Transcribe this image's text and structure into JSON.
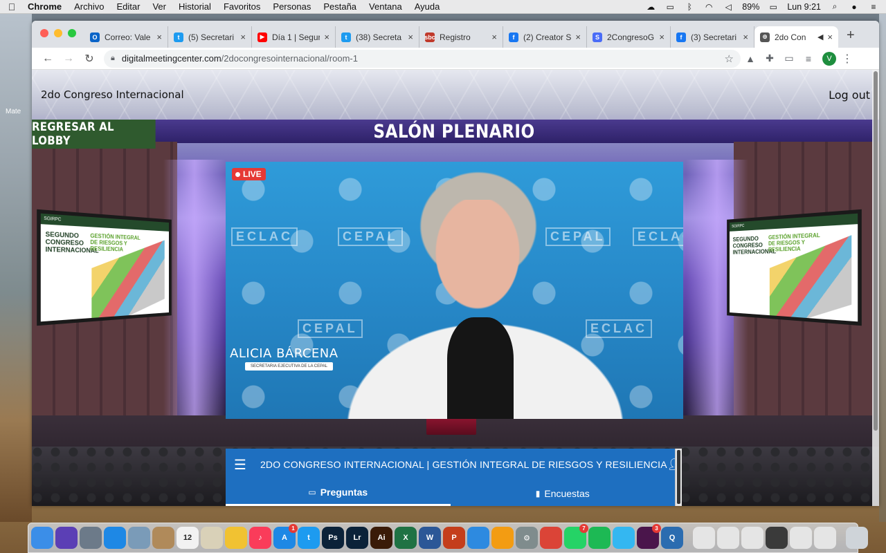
{
  "menubar": {
    "apple_icon": "apple-icon",
    "items": [
      "Chrome",
      "Archivo",
      "Editar",
      "Ver",
      "Historial",
      "Favoritos",
      "Personas",
      "Pestaña",
      "Ventana",
      "Ayuda"
    ],
    "battery": "89%",
    "clock": "Lun 9:21"
  },
  "desktop": {
    "icon_label": "Mate"
  },
  "browser": {
    "tabs": [
      {
        "title": "Correo: Vale",
        "favicon_text": "O",
        "favicon_color": "#0a64c8"
      },
      {
        "title": "(5) Secretari",
        "favicon_text": "t",
        "favicon_color": "#1d9bf0"
      },
      {
        "title": "Día 1 | Segur",
        "favicon_text": "▶",
        "favicon_color": "#ff0000"
      },
      {
        "title": "(38) Secreta",
        "favicon_text": "t",
        "favicon_color": "#1d9bf0"
      },
      {
        "title": "Registro",
        "favicon_text": "sbc",
        "favicon_color": "#c0392b"
      },
      {
        "title": "(2) Creator S",
        "favicon_text": "f",
        "favicon_color": "#1877f2"
      },
      {
        "title": "2CongresoG",
        "favicon_text": "S",
        "favicon_color": "#4a6cf7"
      },
      {
        "title": "(3) Secretari",
        "favicon_text": "f",
        "favicon_color": "#1877f2"
      },
      {
        "title": "2do Con",
        "favicon_text": "⊕",
        "favicon_color": "#555555",
        "active": true
      }
    ],
    "url_host": "digitalmeetingcenter.com",
    "url_path": "/2docongresointernacional/room-1",
    "profile_initial": "V"
  },
  "page": {
    "site_title": "2do Congreso Internacional",
    "logout_label": "Log out",
    "lobby_button": "REGRESAR AL LOBBY",
    "hall_title": "SALÓN PLENARIO",
    "side_screen": {
      "logo_text": "SGIRPC",
      "line1": [
        "SEGUNDO",
        "CONGRESO",
        "INTERNACIONAL"
      ],
      "line2": [
        "GESTIÓN INTEGRAL",
        "DE RIESGOS Y",
        "RESILIENCIA"
      ]
    },
    "video": {
      "live_label": "LIVE",
      "speaker_name": "ALICIA BÁRCENA",
      "speaker_role": "SECRETARIA EJECUTIVA DE LA CEPAL",
      "backdrop_words": [
        "ECLAC",
        "CEPAL",
        "CEPAL",
        "ECLAC",
        "CEPAL",
        "ECLAC"
      ]
    },
    "panel": {
      "title": "2DO CONGRESO INTERNACIONAL | GESTIÓN INTEGRAL DE RIESGOS Y RESILIENCIA",
      "tabs": [
        {
          "label": "Preguntas",
          "icon": "chat-icon",
          "active": true
        },
        {
          "label": "Encuestas",
          "icon": "bar-chart-icon",
          "active": false
        }
      ]
    }
  },
  "dock": {
    "apps": [
      {
        "name": "finder",
        "label": "",
        "color": "#3b8ee8"
      },
      {
        "name": "siri",
        "label": "",
        "color": "#5b3fb5"
      },
      {
        "name": "launchpad",
        "label": "",
        "color": "#6c7a89"
      },
      {
        "name": "safari",
        "label": "",
        "color": "#1e88e5"
      },
      {
        "name": "preview",
        "label": "",
        "color": "#7a9bb8"
      },
      {
        "name": "notes-archive",
        "label": "",
        "color": "#b08a5a"
      },
      {
        "name": "calendar",
        "label": "12",
        "color": "#f2f2f2"
      },
      {
        "name": "contacts",
        "label": "",
        "color": "#d9d1b8"
      },
      {
        "name": "photos",
        "label": "",
        "color": "#f1c232"
      },
      {
        "name": "music",
        "label": "♪",
        "color": "#fa3c5a"
      },
      {
        "name": "app-store",
        "label": "A",
        "color": "#1e88e5",
        "badge": "1"
      },
      {
        "name": "twitter",
        "label": "t",
        "color": "#1d9bf0"
      },
      {
        "name": "photoshop",
        "label": "Ps",
        "color": "#0b2239"
      },
      {
        "name": "lightroom",
        "label": "Lr",
        "color": "#0b2239"
      },
      {
        "name": "illustrator",
        "label": "Ai",
        "color": "#3a1b08"
      },
      {
        "name": "excel",
        "label": "X",
        "color": "#1f7244"
      },
      {
        "name": "word",
        "label": "W",
        "color": "#2b5797"
      },
      {
        "name": "powerpoint",
        "label": "P",
        "color": "#c43e1c"
      },
      {
        "name": "keynote",
        "label": "",
        "color": "#2d8ae0"
      },
      {
        "name": "tunes-app",
        "label": "",
        "color": "#f39c12"
      },
      {
        "name": "system-preferences",
        "label": "⚙",
        "color": "#7f8c8d"
      },
      {
        "name": "chrome",
        "label": "",
        "color": "#db4437"
      },
      {
        "name": "whatsapp",
        "label": "",
        "color": "#25d366",
        "badge": "7"
      },
      {
        "name": "spotify",
        "label": "",
        "color": "#1db954"
      },
      {
        "name": "messages",
        "label": "",
        "color": "#34b7f1"
      },
      {
        "name": "slack",
        "label": "",
        "color": "#4a154b",
        "badge": "3"
      },
      {
        "name": "quicktime",
        "label": "Q",
        "color": "#2b6cb0"
      },
      {
        "name": "files-1",
        "label": "",
        "color": "#e5e5e5"
      },
      {
        "name": "files-2",
        "label": "",
        "color": "#e5e5e5"
      },
      {
        "name": "files-3",
        "label": "",
        "color": "#e5e5e5"
      },
      {
        "name": "files-4",
        "label": "",
        "color": "#3a3a3a"
      },
      {
        "name": "files-5",
        "label": "",
        "color": "#e5e5e5"
      },
      {
        "name": "files-6",
        "label": "",
        "color": "#e5e5e5"
      },
      {
        "name": "trash",
        "label": "",
        "color": "#cfd4d9"
      }
    ]
  }
}
